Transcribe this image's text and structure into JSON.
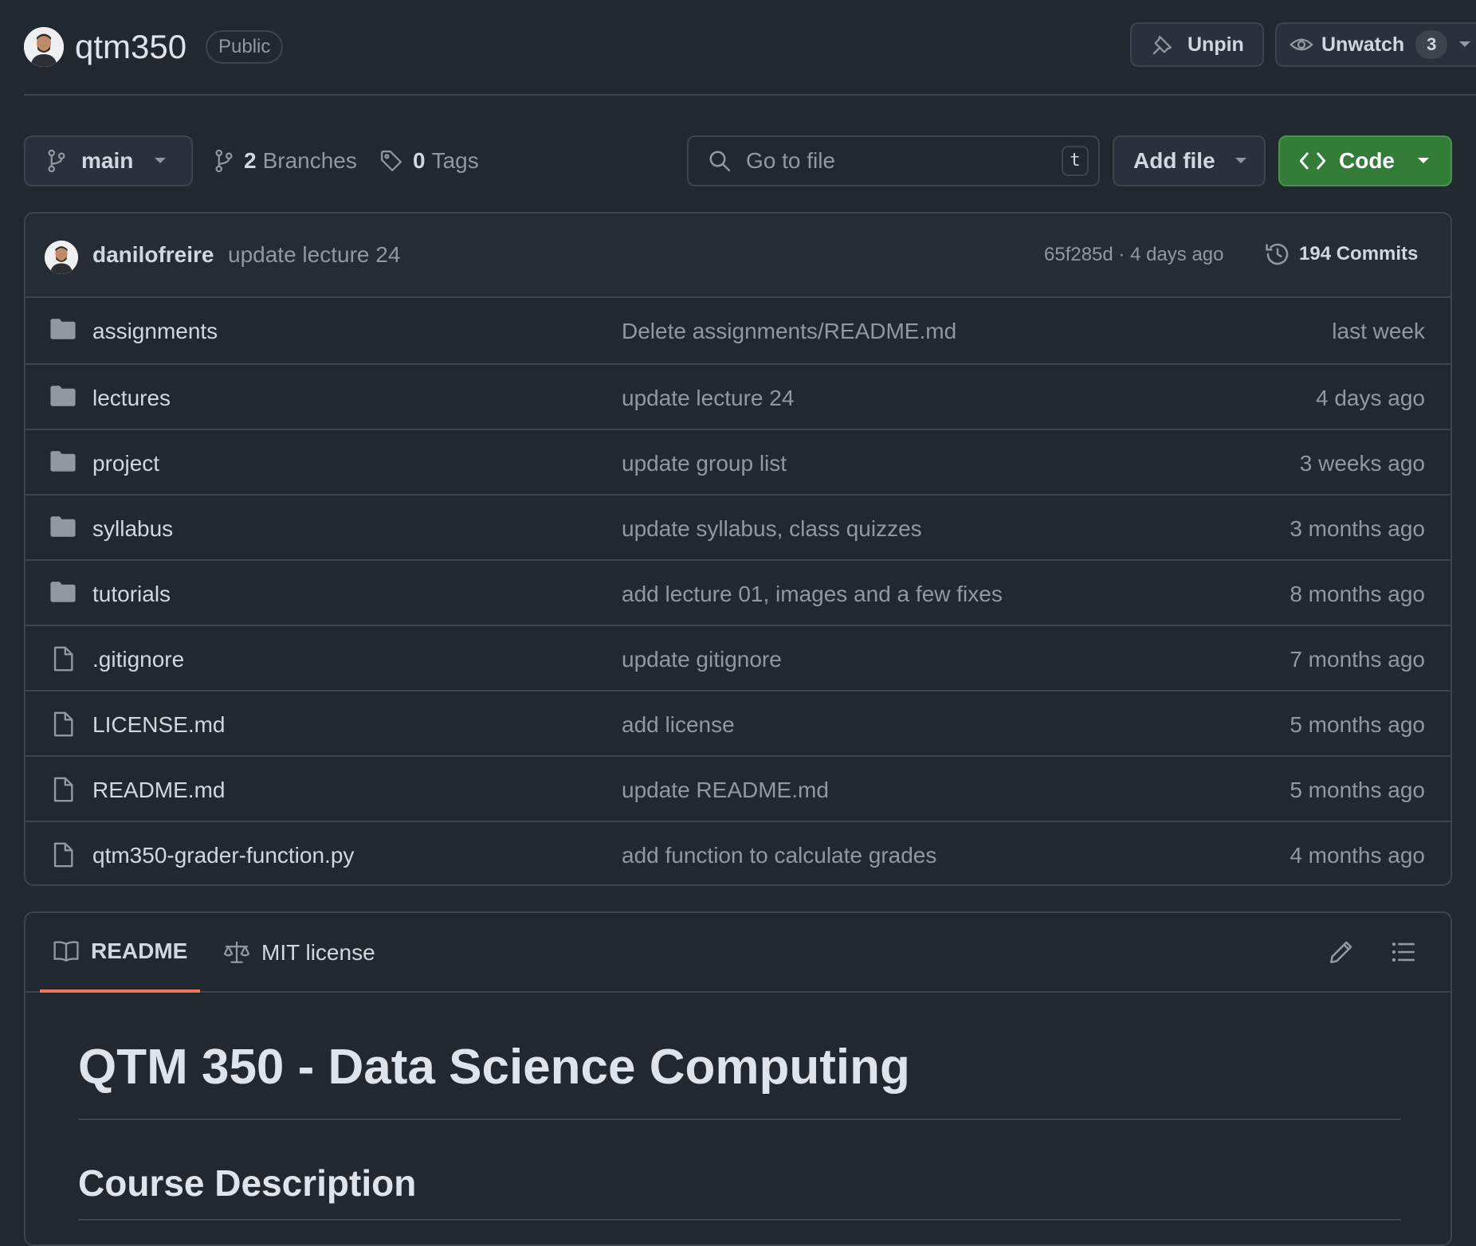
{
  "header": {
    "repo_name": "qtm350",
    "visibility": "Public",
    "unpin_label": "Unpin",
    "unwatch_label": "Unwatch",
    "watch_count": "3"
  },
  "toolbar": {
    "branch": "main",
    "branches_count": "2",
    "branches_label": "Branches",
    "tags_count": "0",
    "tags_label": "Tags",
    "search_placeholder": "Go to file",
    "search_shortcut": "t",
    "add_file_label": "Add file",
    "code_label": "Code"
  },
  "latest_commit": {
    "author": "danilofreire",
    "message": "update lecture 24",
    "meta": "65f285d · 4 days ago",
    "commits_label": "194 Commits"
  },
  "files": [
    {
      "name": "assignments",
      "type": "folder",
      "commit": "Delete assignments/README.md",
      "age": "last week"
    },
    {
      "name": "lectures",
      "type": "folder",
      "commit": "update lecture 24",
      "age": "4 days ago"
    },
    {
      "name": "project",
      "type": "folder",
      "commit": "update group list",
      "age": "3 weeks ago"
    },
    {
      "name": "syllabus",
      "type": "folder",
      "commit": "update syllabus, class quizzes",
      "age": "3 months ago"
    },
    {
      "name": "tutorials",
      "type": "folder",
      "commit": "add lecture 01, images and a few fixes",
      "age": "8 months ago"
    },
    {
      "name": ".gitignore",
      "type": "file",
      "commit": "update gitignore",
      "age": "7 months ago"
    },
    {
      "name": "LICENSE.md",
      "type": "file",
      "commit": "add license",
      "age": "5 months ago"
    },
    {
      "name": "README.md",
      "type": "file",
      "commit": "update README.md",
      "age": "5 months ago"
    },
    {
      "name": "qtm350-grader-function.py",
      "type": "file",
      "commit": "add function to calculate grades",
      "age": "4 months ago"
    }
  ],
  "readme": {
    "tab_readme": "README",
    "tab_license": "MIT license",
    "title": "QTM 350 - Data Science Computing",
    "section_1": "Course Description"
  },
  "colors": {
    "background": "#212830",
    "border": "#3d444d",
    "code_button": "#347d39",
    "active_tab_underline": "#ec775c"
  }
}
